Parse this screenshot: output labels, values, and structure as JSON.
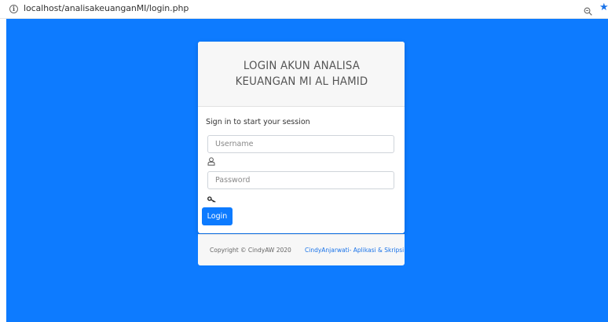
{
  "browser": {
    "url": "localhost/analisakeuanganMI/login.php",
    "info_icon": "i",
    "zoom_icon": "magnifier-icon",
    "bookmark_icon": "star-icon",
    "bookmark_color": "#1a73e8"
  },
  "page": {
    "background_color": "#0d7bff"
  },
  "login_card": {
    "title": "LOGIN AKUN ANALISA KEUANGAN MI AL HAMID",
    "subtitle": "Sign in to start your session",
    "username": {
      "placeholder": "Username",
      "value": "",
      "icon": "user-icon"
    },
    "password": {
      "placeholder": "Password",
      "value": "",
      "icon": "key-icon"
    },
    "login_label": "Login",
    "button_color": "#0d7bff"
  },
  "footer": {
    "copyright": "Copyright © CindyAW 2020",
    "credit_link": "CindyAnjarwati- Aplikasi & Skripsi"
  }
}
